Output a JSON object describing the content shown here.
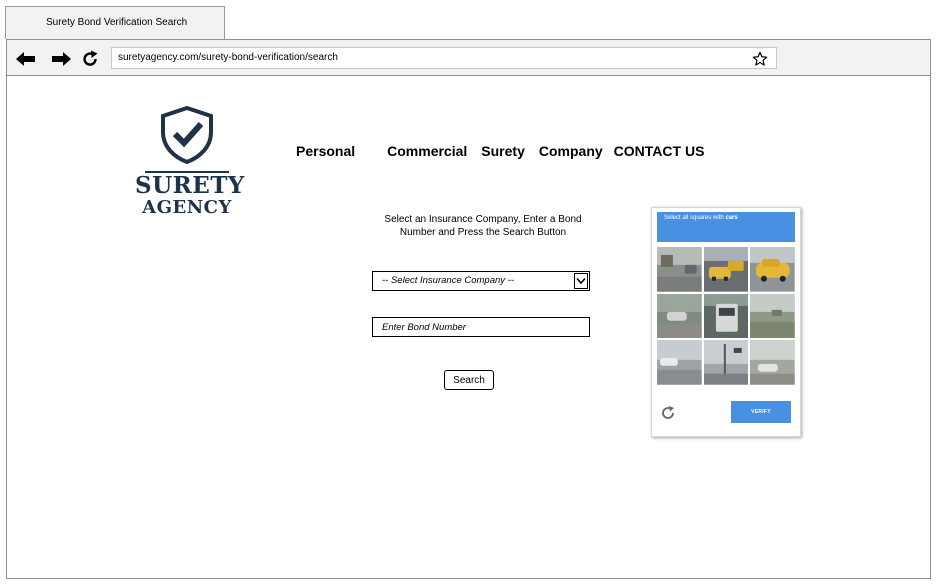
{
  "browser": {
    "tab_title": "Surety Bond Verification Search",
    "url": "suretyagency.com/surety-bond-verification/search",
    "icons": [
      "back-arrow-icon",
      "forward-arrow-icon",
      "reload-icon",
      "star-bookmark-icon"
    ]
  },
  "logo": {
    "line1": "SURETY",
    "line2": "AGENCY",
    "color": "#1f3247",
    "icon": "shield-check-icon"
  },
  "nav": {
    "items": [
      "Personal",
      "Commercial",
      "Surety",
      "Company",
      "CONTACT US"
    ]
  },
  "form": {
    "instructions": "Select an Insurance Company, Enter a Bond Number and Press the Search Button",
    "select_value": "-- Select Insurance Company --",
    "bond_placeholder": "Enter Bond Number",
    "search_label": "Search"
  },
  "captcha": {
    "prompt": "Select all squares with",
    "target": "cars",
    "verify_label": "VERIFY",
    "accent_color": "#4a90e2",
    "icons": [
      "refresh-icon"
    ]
  }
}
